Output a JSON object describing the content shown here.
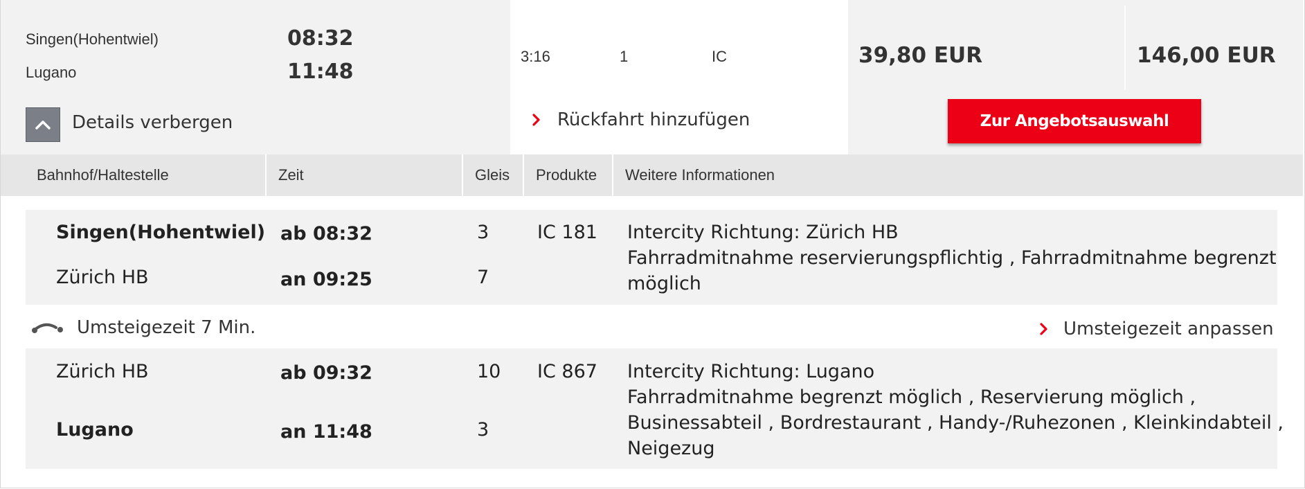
{
  "summary": {
    "from_station": "Singen(Hohentwiel)",
    "to_station": "Lugano",
    "departure": "08:32",
    "arrival": "11:48",
    "duration": "3:16",
    "changes": "1",
    "products": "IC",
    "price_1": "39,80 EUR",
    "price_2": "146,00 EUR",
    "details_toggle_label": "Details verbergen",
    "return_link_label": "Rückfahrt hinzufügen",
    "offer_button_label": "Zur Angebotsauswahl"
  },
  "table_headers": {
    "station": "Bahnhof/Haltestelle",
    "time": "Zeit",
    "platform": "Gleis",
    "products": "Produkte",
    "info": "Weitere Informationen"
  },
  "legs": [
    {
      "from": "Singen(Hohentwiel)",
      "dep": "ab 08:32",
      "dep_platform": "3",
      "to": "Zürich HB",
      "arr": "an 09:25",
      "arr_platform": "7",
      "product": "IC 181",
      "info_line1": "Intercity Richtung: Zürich HB",
      "info_line2": "Fahrradmitnahme reservierungspflichtig , Fahrradmitnahme begrenzt",
      "info_line3": "möglich"
    },
    {
      "from": "Zürich HB",
      "dep": "ab 09:32",
      "dep_platform": "10",
      "to": "Lugano",
      "arr": "an 11:48",
      "arr_platform": "3",
      "product": "IC 867",
      "info_line1": "Intercity Richtung: Lugano",
      "info_line2": "Fahrradmitnahme begrenzt möglich , Reservierung möglich ,",
      "info_line3": "Businessabteil , Bordrestaurant , Handy-/Ruhezonen , Kleinkindabteil ,",
      "info_line4": "Neigezug"
    }
  ],
  "transfer": {
    "label": "Umsteigezeit 7 Min.",
    "adjust_label": "Umsteigezeit anpassen"
  },
  "colors": {
    "accent_red": "#ec0016",
    "header_gray": "#e6e6e6",
    "row_gray": "#f2f2f2"
  },
  "icons": [
    "chevron-up-icon",
    "chevron-right-icon",
    "transfer-walk-icon"
  ]
}
